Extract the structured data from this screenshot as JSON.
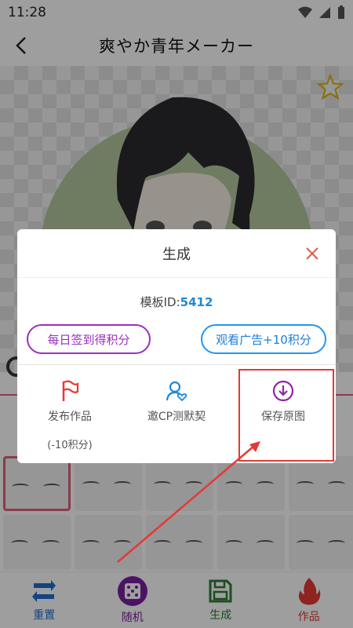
{
  "status_bar": {
    "time": "11:28"
  },
  "header": {
    "title": "爽やか青年メーカー"
  },
  "dialog": {
    "title": "生成",
    "template_label": "模板ID:",
    "template_id": "5412",
    "checkin_button": "每日签到得积分",
    "ad_button": "观看广告+10积分",
    "actions": [
      {
        "label": "发布作品",
        "sublabel": "(-10积分)",
        "icon": "flag-icon"
      },
      {
        "label": "邀CP测默契",
        "icon": "user-heart-icon"
      },
      {
        "label": "保存原图",
        "icon": "download-icon"
      }
    ]
  },
  "bottom_nav": [
    {
      "label": "重置",
      "icon": "reset-icon",
      "color": "#1e6fd0"
    },
    {
      "label": "随机",
      "icon": "dice-icon",
      "color": "#7b1fa2"
    },
    {
      "label": "生成",
      "icon": "save-icon",
      "color": "#2e7d32"
    },
    {
      "label": "作品",
      "icon": "fire-icon",
      "color": "#e53935"
    }
  ],
  "colors": {
    "accent_purple": "#9b2fbf",
    "accent_blue": "#2196f3",
    "highlight_red": "#e53935",
    "avatar_bg": "#b5c99f"
  }
}
